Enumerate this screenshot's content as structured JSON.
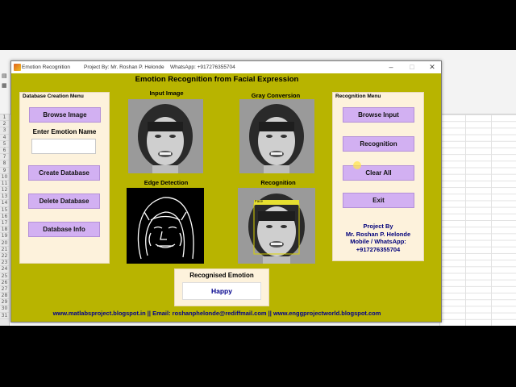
{
  "window": {
    "app_title": "Emotion Recognition",
    "project_by": "Project By: Mr. Roshan P. Helonde",
    "whatsapp": "WhatsApp: +917276355704"
  },
  "main_title": "Emotion Recognition from Facial Expression",
  "database_menu": {
    "title": "Database Creation Menu",
    "browse_image": "Browse Image",
    "emotion_name_label": "Enter Emotion Name",
    "emotion_name_value": "",
    "create_database": "Create Database",
    "delete_database": "Delete Database",
    "database_info": "Database Info"
  },
  "images": {
    "input": "Input Image",
    "gray": "Gray Conversion",
    "edge": "Edge Detection",
    "recognition": "Recognition",
    "face_box_label": "Face"
  },
  "recognition_menu": {
    "title": "Recognition Menu",
    "browse_input": "Browse Input",
    "recognition": "Recognition",
    "clear_all": "Clear All",
    "exit": "Exit",
    "credits": [
      "Project By",
      "Mr. Roshan P. Helonde",
      "Mobile / WhatsApp:",
      "+917276355704"
    ]
  },
  "result": {
    "title": "Recognised Emotion",
    "value": "Happy"
  },
  "footer": "www.matlabsproject.blogspot.in  || Email: roshanphelonde@rediffmail.com ||  www.enggprojectworld.blogspot.com",
  "colors": {
    "figure_bg": "#b8b400",
    "panel_bg": "#fdf2dc",
    "button_bg": "#d2b0f2",
    "footer_text": "#00008c",
    "result_text": "#00008c"
  }
}
